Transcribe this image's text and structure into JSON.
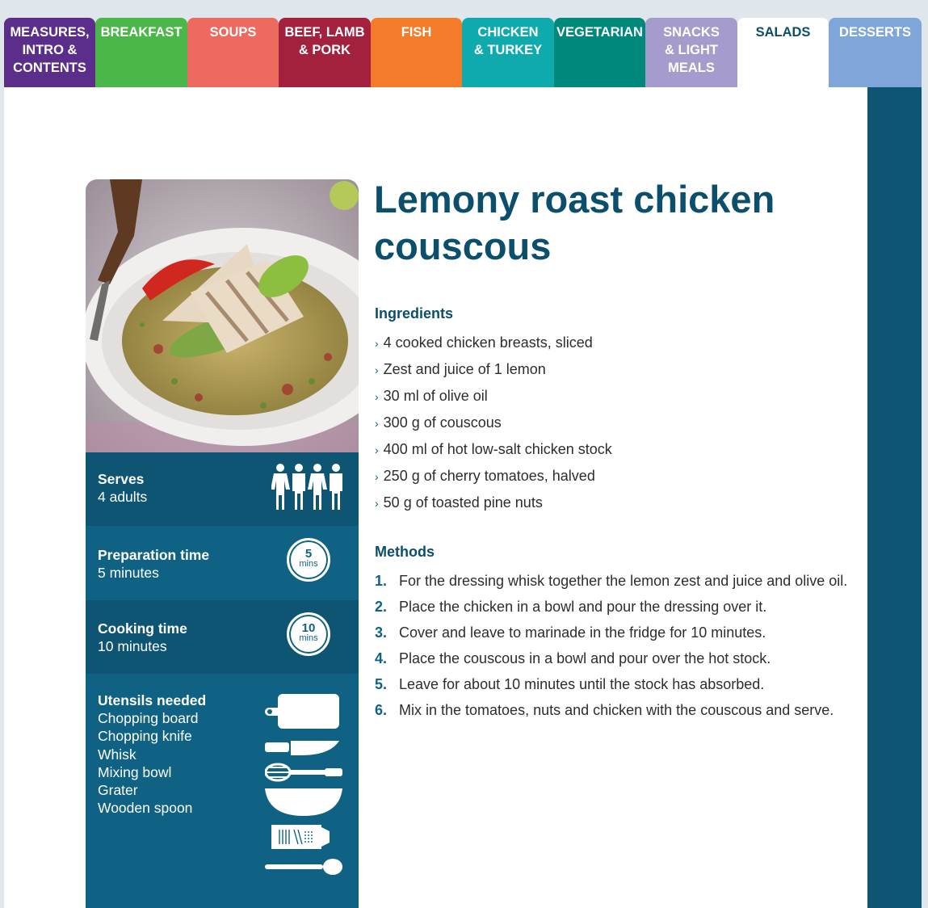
{
  "tabs": [
    {
      "label": "MEASURES,\nINTRO &\nCONTENTS",
      "color": "#5b2e8c",
      "active": false
    },
    {
      "label": "BREAKFAST",
      "color": "#4bb748",
      "active": false
    },
    {
      "label": "SOUPS",
      "color": "#ee6a60",
      "active": false
    },
    {
      "label": "BEEF, LAMB\n& PORK",
      "color": "#a3213d",
      "active": false
    },
    {
      "label": "FISH",
      "color": "#f47b29",
      "active": false
    },
    {
      "label": "CHICKEN\n& TURKEY",
      "color": "#0faaad",
      "active": false
    },
    {
      "label": "VEGETARIAN",
      "color": "#00897a",
      "active": false
    },
    {
      "label": "SNACKS\n& LIGHT\nMEALS",
      "color": "#a59ccd",
      "active": false
    },
    {
      "label": "SALADS",
      "color": "#ffffff",
      "active": true
    },
    {
      "label": "DESSERTS",
      "color": "#7fa6d8",
      "active": false
    }
  ],
  "recipe": {
    "title": "Lemony roast chicken couscous",
    "serves": {
      "label": "Serves",
      "value": "4 adults",
      "icon": "people-icon"
    },
    "prep": {
      "label": "Preparation time",
      "value": "5 minutes",
      "clock_num": "5",
      "clock_unit": "mins"
    },
    "cook": {
      "label": "Cooking time",
      "value": "10 minutes",
      "clock_num": "10",
      "clock_unit": "mins"
    },
    "utensils": {
      "label": "Utensils needed",
      "items": [
        "Chopping board",
        "Chopping knife",
        "Whisk",
        "Mixing bowl",
        "Grater",
        "Wooden spoon"
      ]
    },
    "ingredients_heading": "Ingredients",
    "ingredients": [
      "4 cooked chicken breasts, sliced",
      "Zest and juice of 1 lemon",
      "30 ml of olive oil",
      "300 g of couscous",
      "400 ml of hot low-salt chicken stock",
      "250 g of cherry tomatoes, halved",
      "50 g of toasted pine nuts"
    ],
    "methods_heading": "Methods",
    "methods": [
      "For the dressing whisk together the lemon zest and juice and olive oil.",
      "Place the chicken in a bowl and pour the dressing over it.",
      "Cover and leave to marinade in the fridge for 10 minutes.",
      "Place the couscous in a bowl and pour over the hot stock.",
      "Leave for about 10 minutes until the stock has absorbed.",
      "Mix in the tomatoes, nuts and chicken with the couscous and serve."
    ]
  },
  "colors": {
    "accent_dark": "#0e5574",
    "accent": "#0f6283",
    "title": "#0b4f6c"
  }
}
